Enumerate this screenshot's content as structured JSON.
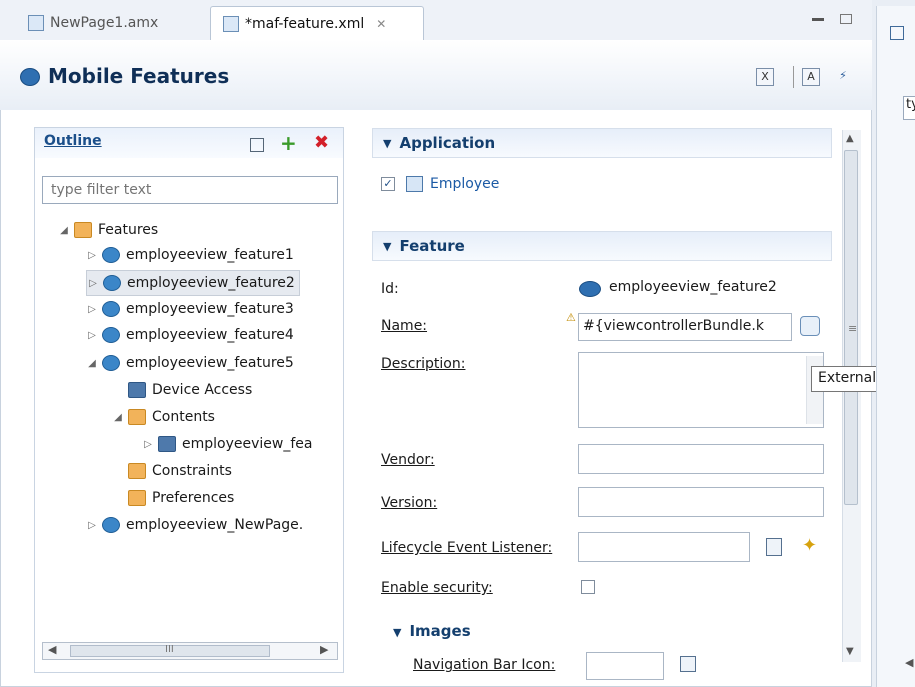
{
  "tabs": [
    {
      "label": "NewPage1.amx",
      "active": false
    },
    {
      "label": "*maf-feature.xml",
      "active": true
    }
  ],
  "editor": {
    "title": "Mobile Features"
  },
  "outline": {
    "title": "Outline",
    "filter_placeholder": "type filter text",
    "tree": [
      {
        "label": "Features",
        "level": 0,
        "expanded": true,
        "icon": "folder-icon"
      },
      {
        "label": "employeeview_feature1",
        "level": 1,
        "expanded": false,
        "icon": "feature-icon"
      },
      {
        "label": "employeeview_feature2",
        "level": 1,
        "expanded": false,
        "icon": "feature-icon",
        "selected": true
      },
      {
        "label": "employeeview_feature3",
        "level": 1,
        "expanded": false,
        "icon": "feature-icon"
      },
      {
        "label": "employeeview_feature4",
        "level": 1,
        "expanded": false,
        "icon": "feature-icon"
      },
      {
        "label": "employeeview_feature5",
        "level": 1,
        "expanded": true,
        "icon": "feature-icon"
      },
      {
        "label": "Device Access",
        "level": 2,
        "icon": "device-access-icon"
      },
      {
        "label": "Contents",
        "level": 2,
        "expanded": true,
        "icon": "folder-icon"
      },
      {
        "label": "employeeview_fea",
        "level": 3,
        "expanded": false,
        "icon": "content-icon"
      },
      {
        "label": "Constraints",
        "level": 2,
        "icon": "folder-icon"
      },
      {
        "label": "Preferences",
        "level": 2,
        "icon": "folder-icon"
      },
      {
        "label": "employeeview_NewPage.",
        "level": 1,
        "expanded": false,
        "icon": "feature-icon"
      }
    ],
    "hscroll_marker": "III"
  },
  "application": {
    "section_title": "Application",
    "employee_label": "Employee",
    "employee_checked": true
  },
  "feature": {
    "section_title": "Feature",
    "id_label": "Id:",
    "id_value": "employeeview_feature2",
    "name_label": "Name:",
    "name_value": "#{viewcontrollerBundle.k",
    "description_label": "Description:",
    "vendor_label": "Vendor:",
    "version_label": "Version:",
    "lifecycle_label": "Lifecycle Event Listener:",
    "security_label": "Enable security:",
    "security_checked": false
  },
  "images": {
    "section_title": "Images",
    "nav_icon_label": "Navigation Bar Icon:"
  },
  "tooltip": "Externalize",
  "rightpane": {
    "partial_text": "ty"
  }
}
